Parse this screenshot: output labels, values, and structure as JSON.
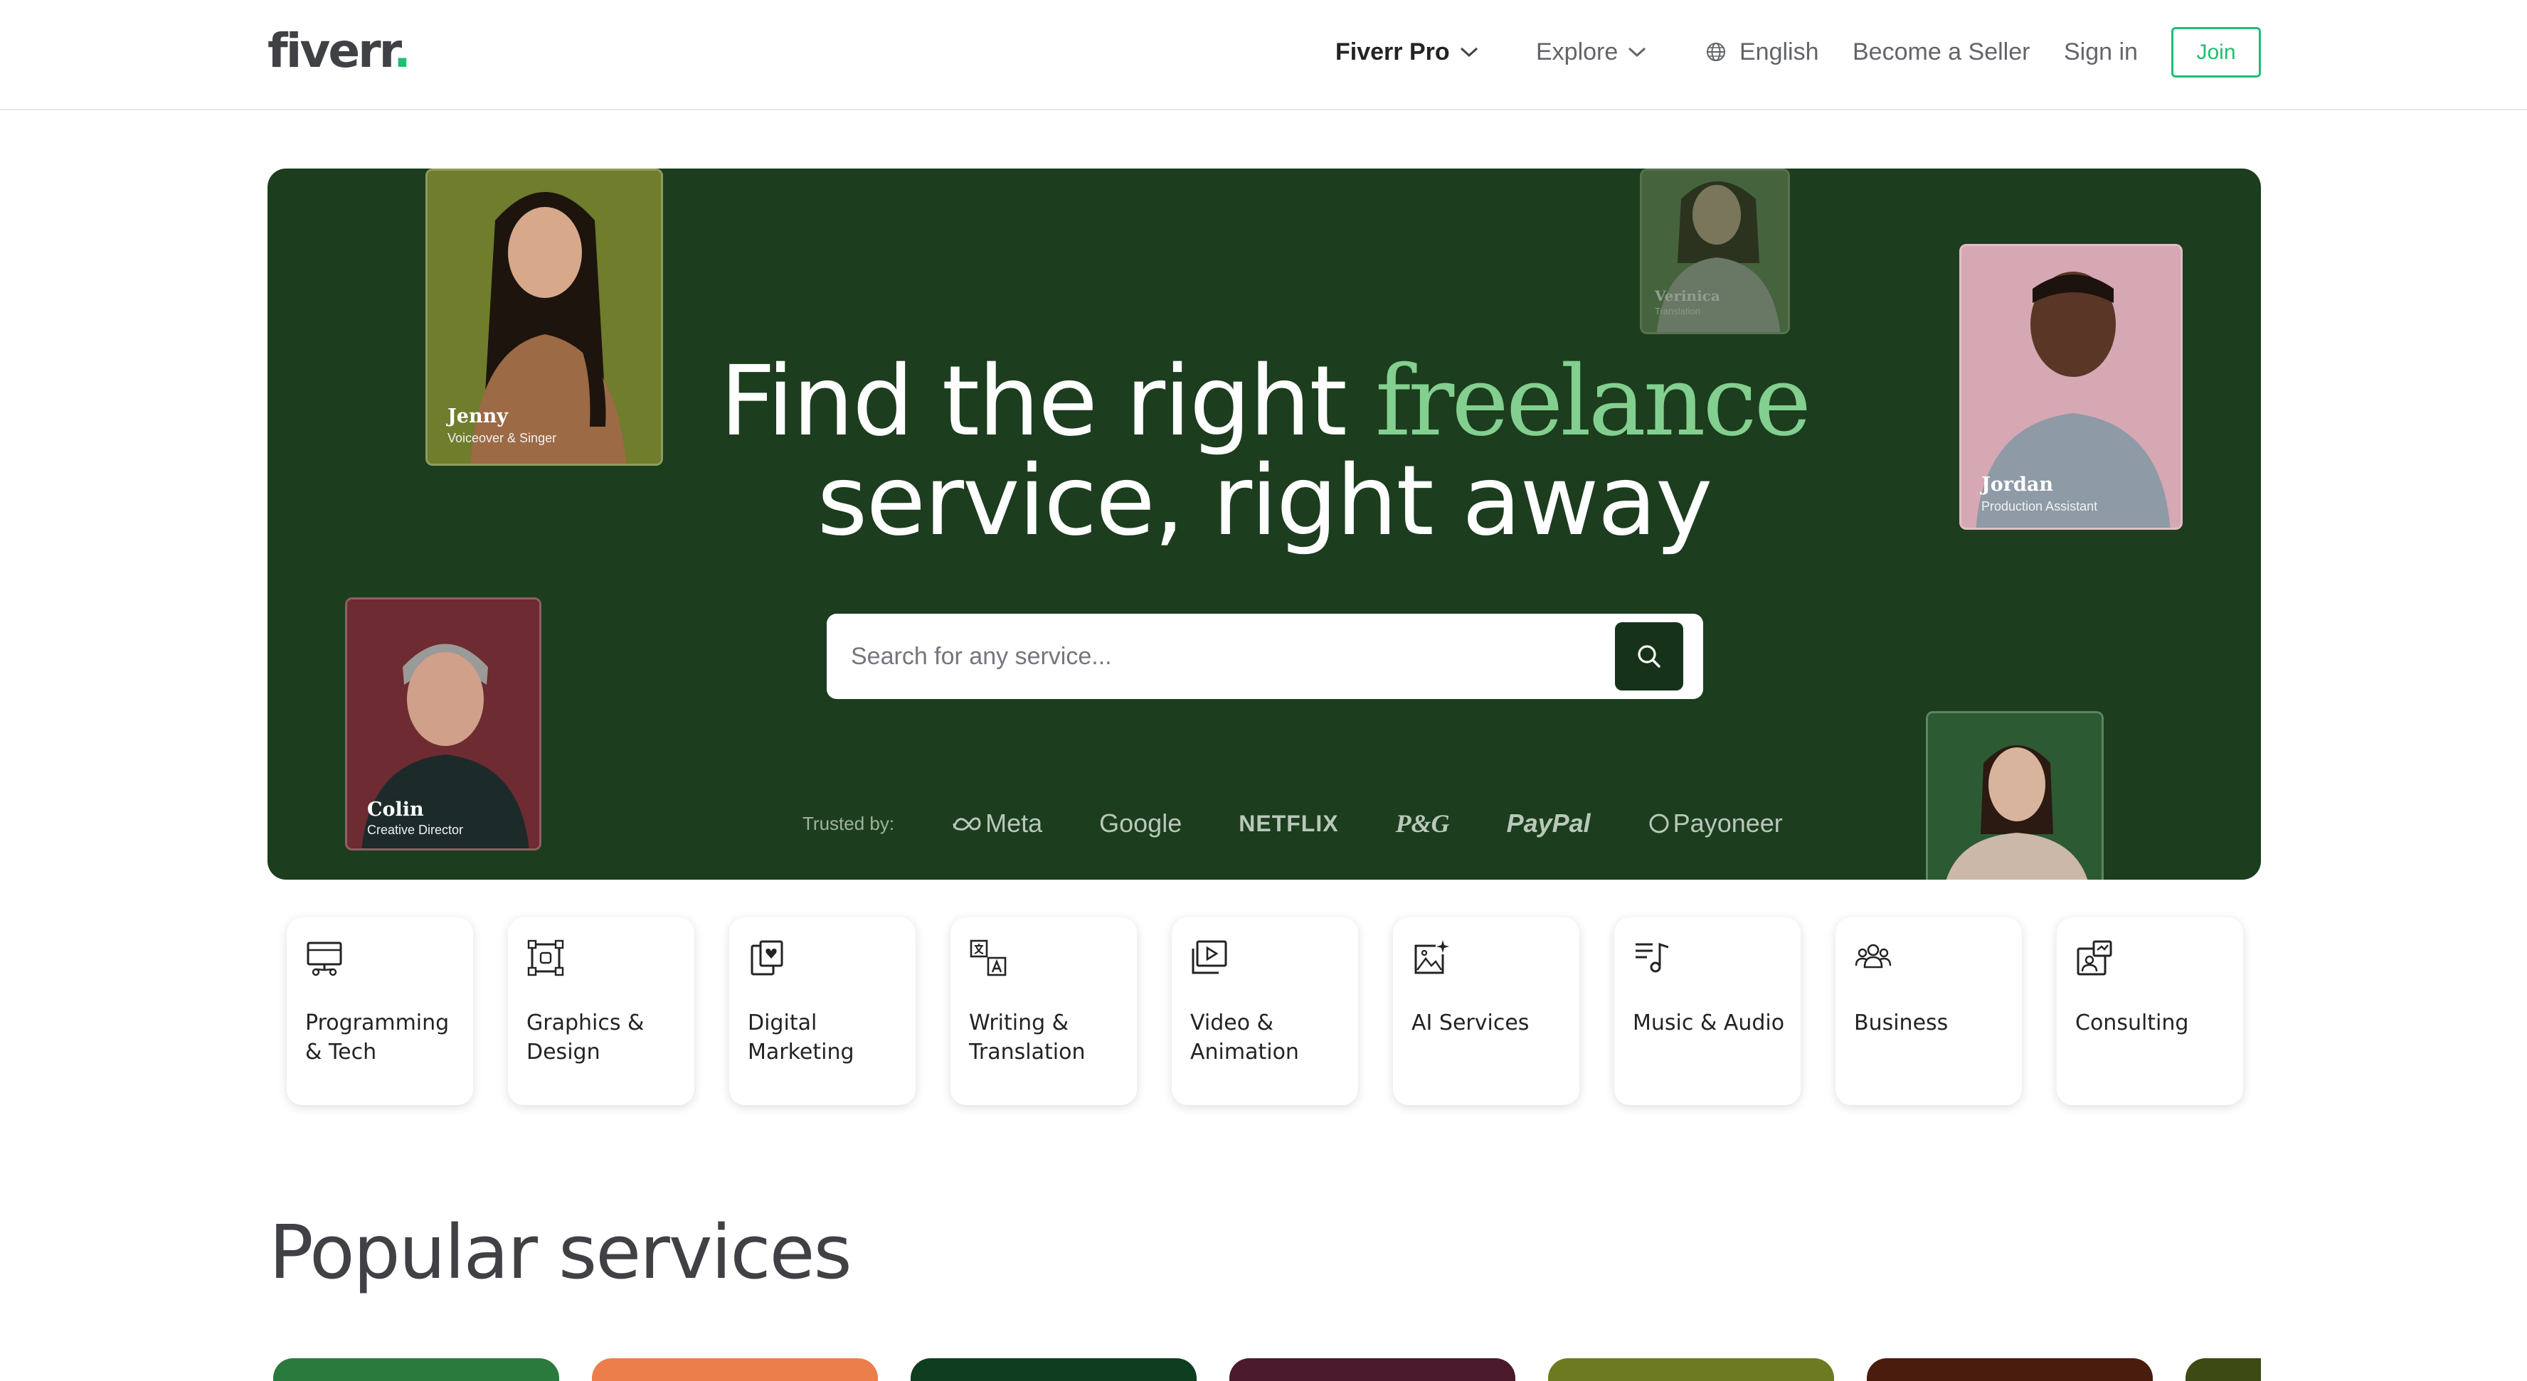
{
  "header": {
    "logo": "fiverr",
    "logo_dot": ".",
    "nav": {
      "fiverr_pro": "Fiverr Pro",
      "explore": "Explore",
      "language": "English",
      "become_seller": "Become a Seller",
      "sign_in": "Sign in",
      "join": "Join"
    }
  },
  "hero": {
    "title_part1": "Find the right ",
    "title_accent": "freelance",
    "title_line2": "service, right away",
    "search_placeholder": "Search for any service...",
    "trusted_label": "Trusted by:",
    "brands": [
      "Meta",
      "Google",
      "NETFLIX",
      "P&G",
      "PayPal",
      "Payoneer"
    ],
    "freelancers": [
      {
        "name": "Jenny",
        "role": "Voiceover & Singer"
      },
      {
        "name": "Colin",
        "role": "Creative Director"
      },
      {
        "name": "Verinica",
        "role": "Translation"
      },
      {
        "name": "Jordan",
        "role": "Production Assistant"
      }
    ]
  },
  "categories": [
    {
      "label": "Programming & Tech",
      "icon": "monitor-code-icon"
    },
    {
      "label": "Graphics & Design",
      "icon": "design-frame-icon"
    },
    {
      "label": "Digital Marketing",
      "icon": "marketing-heart-icon"
    },
    {
      "label": "Writing & Translation",
      "icon": "translation-icon"
    },
    {
      "label": "Video & Animation",
      "icon": "video-play-icon"
    },
    {
      "label": "AI Services",
      "icon": "ai-image-icon"
    },
    {
      "label": "Music & Audio",
      "icon": "music-note-icon"
    },
    {
      "label": "Business",
      "icon": "people-icon"
    },
    {
      "label": "Consulting",
      "icon": "consulting-chart-icon"
    }
  ],
  "popular": {
    "title": "Popular services",
    "card_colors": [
      "#2a7a3e",
      "#ec7e4b",
      "#0e3e1e",
      "#4a1a2c",
      "#6e7a1f",
      "#4a1c0e",
      "#3c4a14"
    ]
  },
  "colors": {
    "brand_green": "#1dbf73",
    "hero_bg": "#1c3d1e",
    "accent_text": "#83cf8f"
  }
}
